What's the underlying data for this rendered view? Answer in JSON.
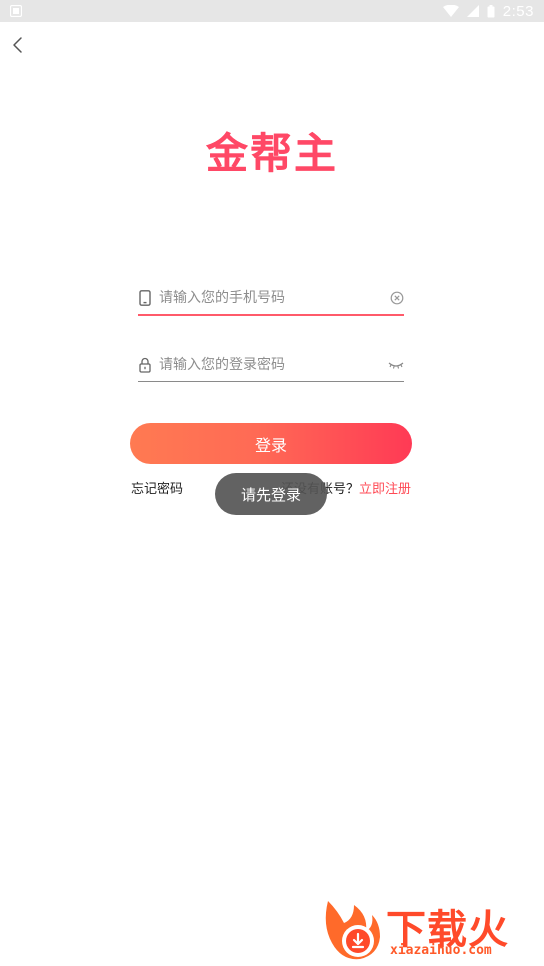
{
  "status_bar": {
    "time": "2:53"
  },
  "brand": {
    "logo_text": "金帮主",
    "color": "#ff4866"
  },
  "form": {
    "phone_placeholder": "请输入您的手机号码",
    "password_placeholder": "请输入您的登录密码",
    "login_label": "登录",
    "forgot_label": "忘记密码",
    "no_account_label": "还没有账号？",
    "register_label": "立即注册"
  },
  "toast": {
    "message": "请先登录"
  },
  "watermark": {
    "title": "下载火",
    "domain": "xiazaihuo.com"
  },
  "colors": {
    "accent": "#ff4a55",
    "button_start": "#ff7a52",
    "button_end": "#ff3a55"
  },
  "icons": {
    "back": "chevron-left-icon",
    "phone": "phone-icon",
    "lock": "lock-icon",
    "clear": "clear-icon",
    "eye": "eye-closed-icon"
  }
}
